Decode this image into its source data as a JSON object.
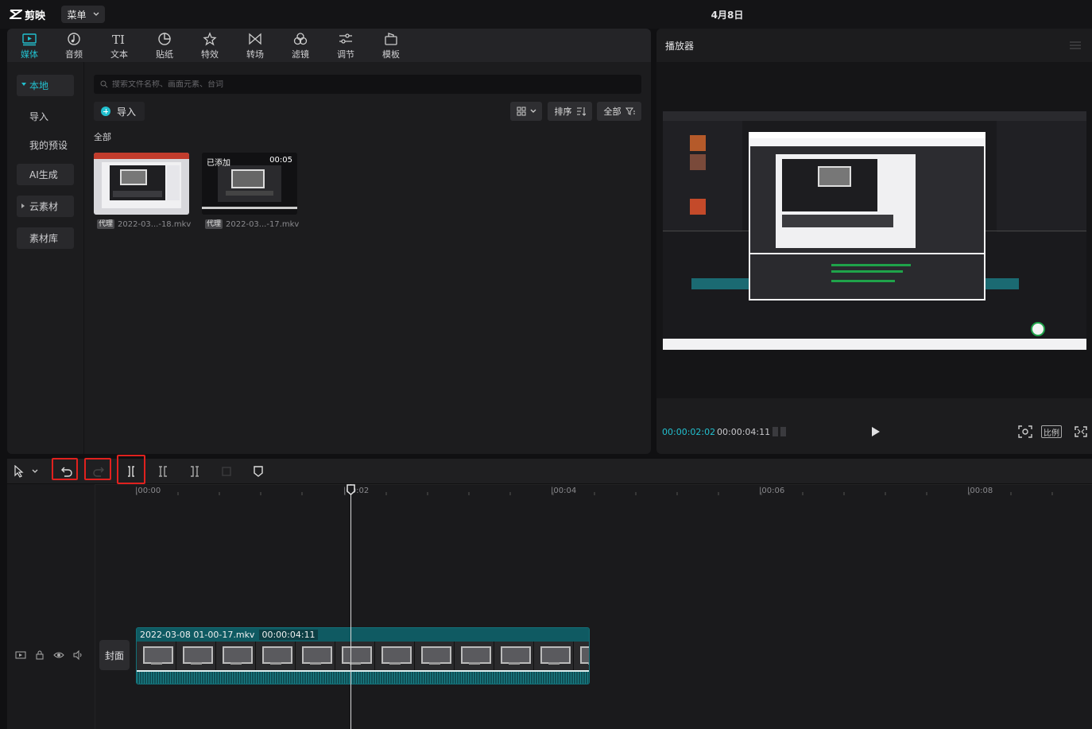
{
  "app": {
    "name": "剪映",
    "menu_label": "菜单",
    "date": "4月8日"
  },
  "tabs": [
    {
      "label": "媒体",
      "icon": "media-icon",
      "active": true
    },
    {
      "label": "音频",
      "icon": "audio-icon"
    },
    {
      "label": "文本",
      "icon": "text-icon"
    },
    {
      "label": "贴纸",
      "icon": "sticker-icon"
    },
    {
      "label": "特效",
      "icon": "effects-icon"
    },
    {
      "label": "转场",
      "icon": "transition-icon"
    },
    {
      "label": "滤镜",
      "icon": "filter-icon"
    },
    {
      "label": "调节",
      "icon": "adjust-icon"
    },
    {
      "label": "模板",
      "icon": "template-icon"
    }
  ],
  "sidebar": {
    "items": [
      {
        "label": "本地"
      },
      {
        "label": "导入"
      },
      {
        "label": "我的预设"
      },
      {
        "label": "AI生成"
      },
      {
        "label": "云素材"
      },
      {
        "label": "素材库"
      }
    ]
  },
  "media": {
    "search_placeholder": "搜索文件名称、画面元素、台词",
    "import_label": "导入",
    "sort_label": "排序",
    "filter_label": "全部",
    "section_label": "全部",
    "files": [
      {
        "name": "2022-03...-18.mkv",
        "tag": "代理",
        "duration": "",
        "badge": ""
      },
      {
        "name": "2022-03...-17.mkv",
        "tag": "代理",
        "duration": "00:05",
        "badge": "已添加"
      }
    ]
  },
  "player": {
    "title": "播放器",
    "current_time": "00:00:02:02",
    "total_time": "00:00:04:11",
    "ratio_label": "比例"
  },
  "timeline": {
    "ticks": [
      "|00:00",
      "|00:02",
      "|00:04",
      "|00:06",
      "|00:08"
    ],
    "cover_label": "封面",
    "clip": {
      "name": "2022-03-08 01-00-17.mkv",
      "duration": "00:00:04:11"
    }
  },
  "colors": {
    "accent": "#22c0cf",
    "highlight": "#e0211e",
    "clip": "#0f4f55"
  }
}
